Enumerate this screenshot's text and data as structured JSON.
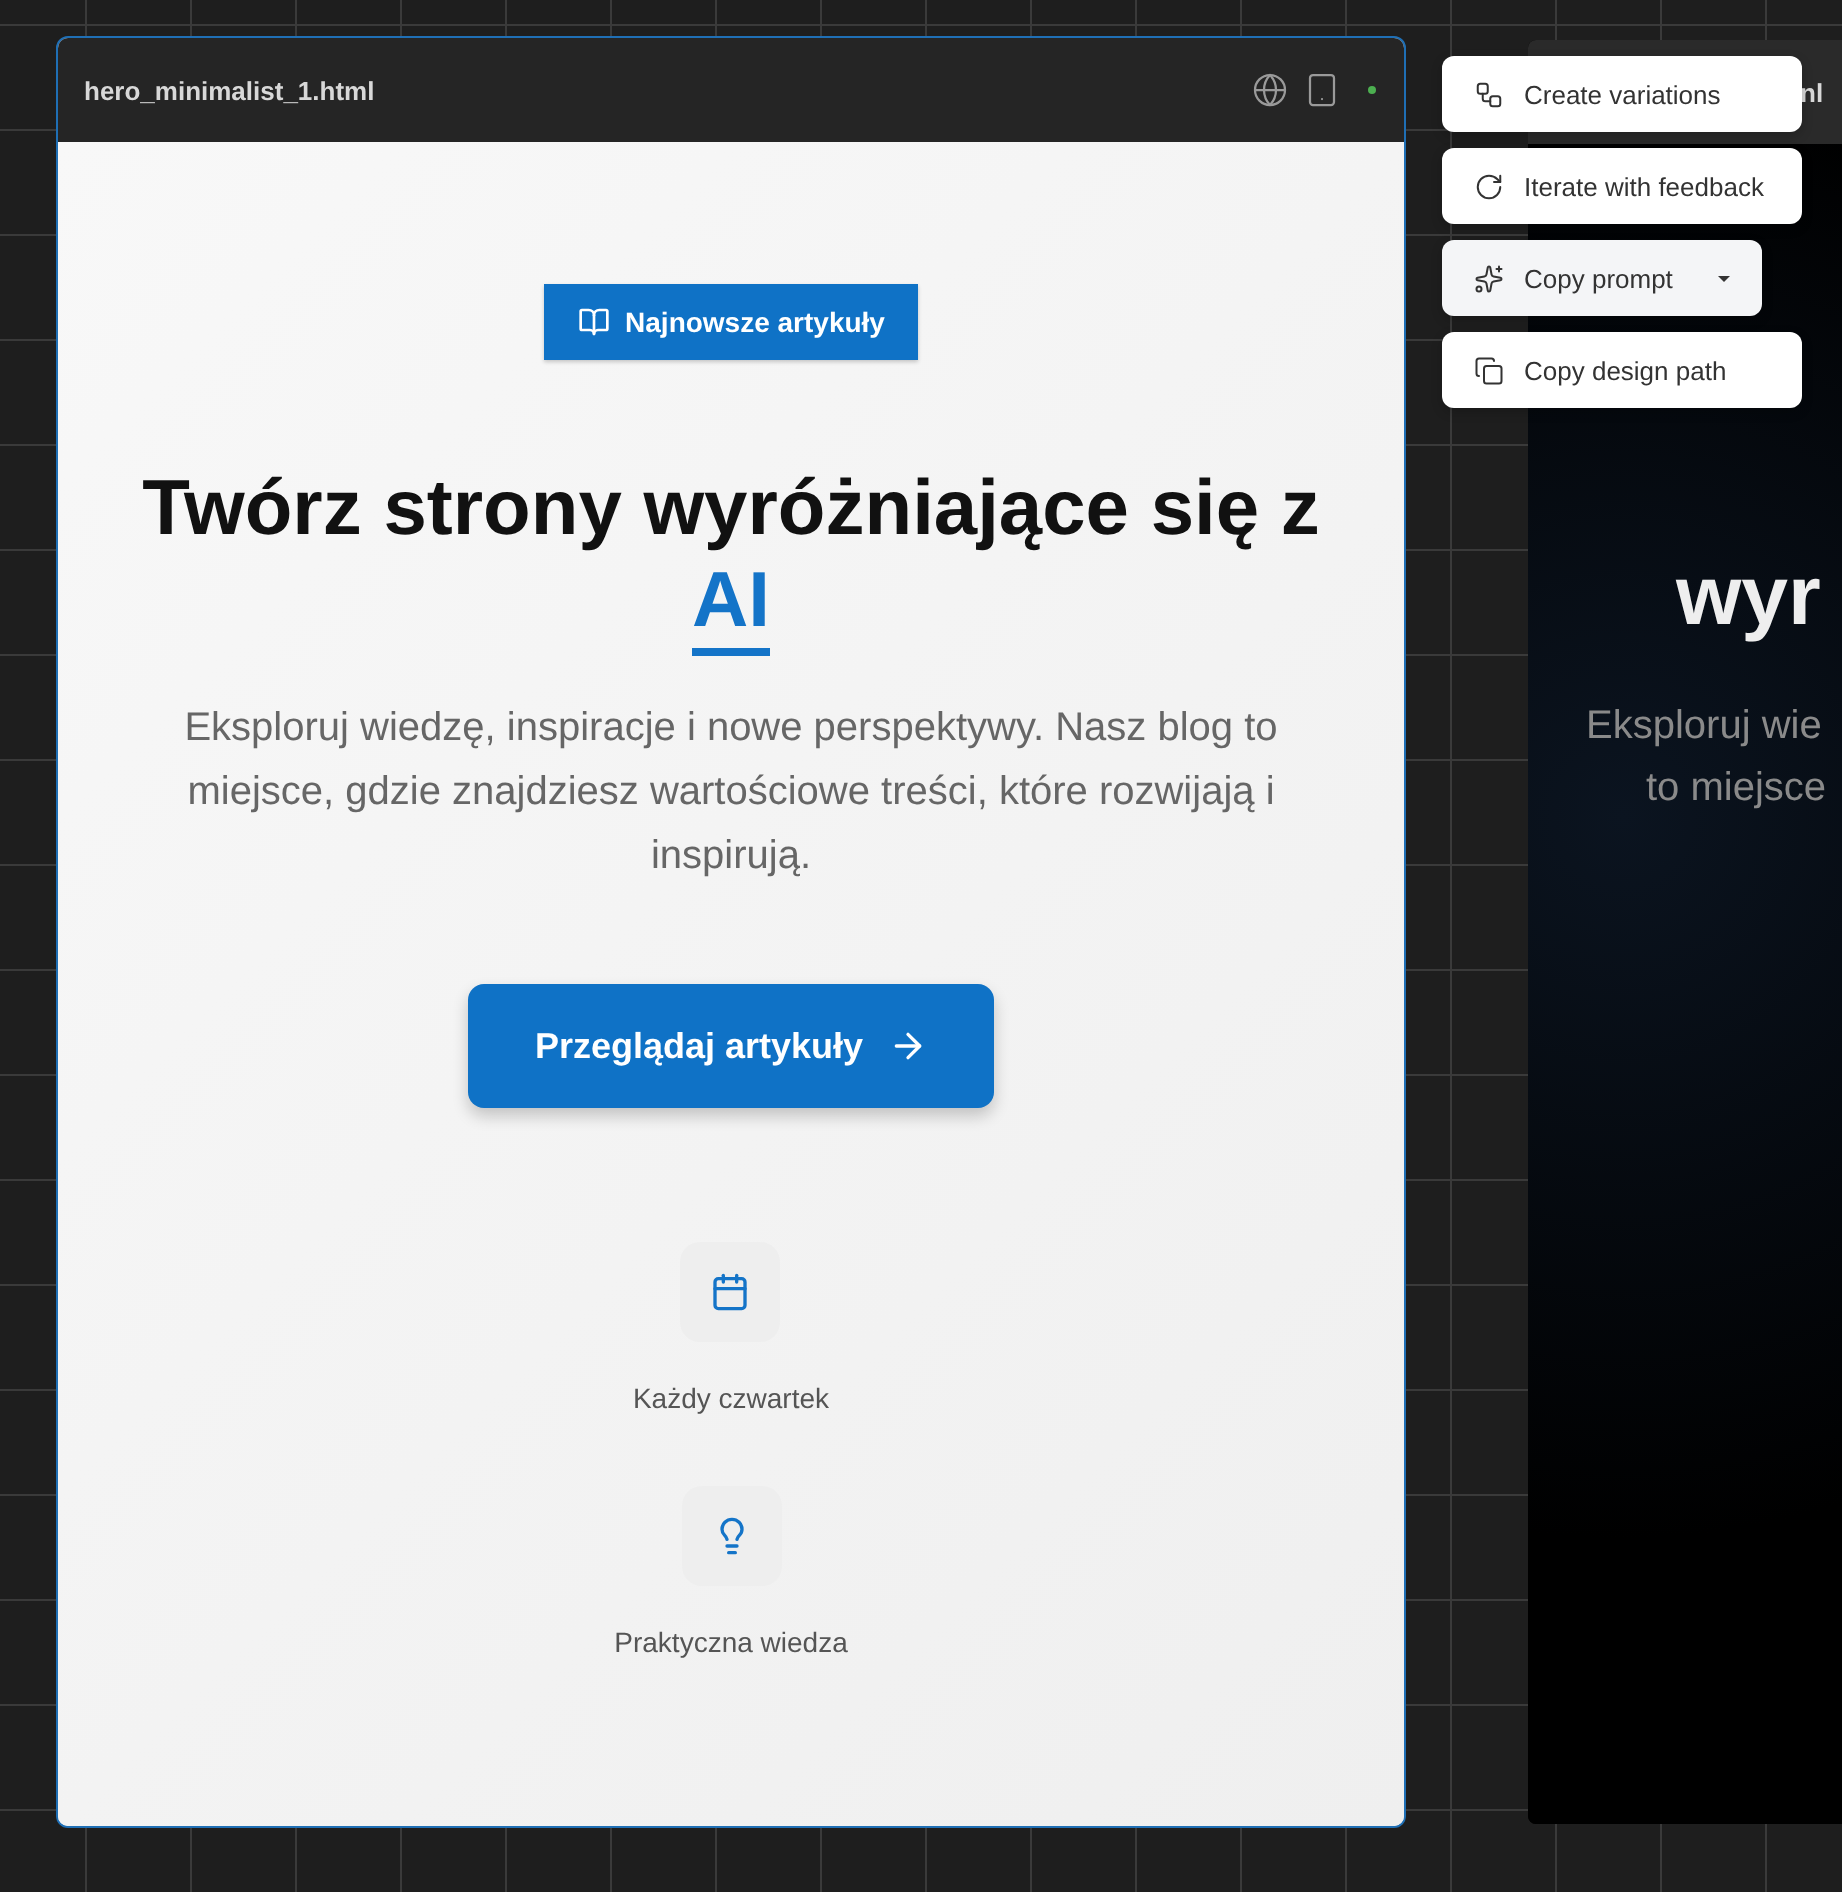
{
  "frame": {
    "title": "hero_minimalist_1.html"
  },
  "hero": {
    "badge": "Najnowsze artykuły",
    "heading_text": "Twórz strony wyróżniające się z",
    "heading_highlight": "AI",
    "subtitle": "Eksploruj wiedzę, inspiracje i nowe perspektywy. Nasz blog to miejsce, gdzie znajdziesz wartościowe treści, które rozwijają i inspirują.",
    "cta": "Przeglądaj artykuły",
    "features": [
      {
        "kind": "calendar",
        "label": "Każdy czwartek"
      },
      {
        "kind": "bulb",
        "label": "Praktyczna wiedza"
      }
    ]
  },
  "second_frame": {
    "title": "nl",
    "heading": "wyr",
    "subtitle_lines": [
      "Eksploruj wie",
      "to miejsce"
    ]
  },
  "menu": [
    {
      "kind": "variations",
      "label": "Create variations",
      "dropdown": false
    },
    {
      "kind": "iterate",
      "label": "Iterate with feedback",
      "dropdown": false
    },
    {
      "kind": "prompt",
      "label": "Copy prompt",
      "dropdown": true
    },
    {
      "kind": "copy",
      "label": "Copy design path",
      "dropdown": false
    }
  ]
}
